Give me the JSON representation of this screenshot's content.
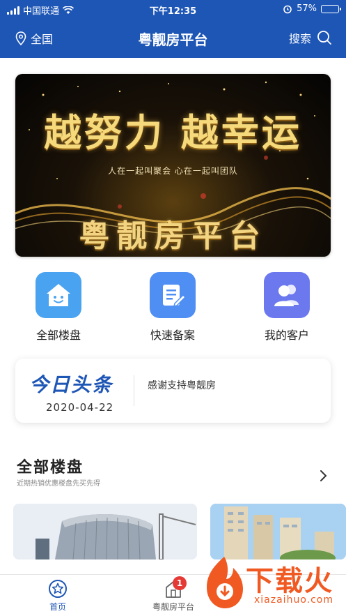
{
  "status_bar": {
    "carrier": "中国联通",
    "time": "下午12:35",
    "battery_percent": "57%",
    "battery_level": 0.57
  },
  "nav": {
    "location": "全国",
    "title": "粤靓房平台",
    "search_label": "搜索"
  },
  "banner": {
    "slogan": "越努力 越幸运",
    "subtitle": "人在一起叫聚会 心在一起叫团队",
    "brand": "粤靓房平台"
  },
  "actions": [
    {
      "label": "全部楼盘",
      "icon": "house-smile-icon",
      "color": "#4aa3f0"
    },
    {
      "label": "快速备案",
      "icon": "edit-document-icon",
      "color": "#4f8ef2"
    },
    {
      "label": "我的客户",
      "icon": "users-icon",
      "color": "#6b78ee"
    }
  ],
  "news": {
    "heading": "今日头条",
    "date": "2020-04-22",
    "text": "感谢支持粤靓房"
  },
  "section": {
    "title": "全部楼盘",
    "subtitle": "近期热销优惠楼盘先买先得"
  },
  "tabbar": {
    "items": [
      {
        "label": "首页",
        "icon": "star-circle-icon",
        "active": true
      },
      {
        "label": "粤靓房平台",
        "icon": "building-icon",
        "badge": "1"
      }
    ]
  },
  "watermark": {
    "text": "下载火",
    "url": "xiazaihuo.com"
  },
  "colors": {
    "primary": "#1e56b6",
    "banner_gold": "#f3d480",
    "badge_red": "#e53935",
    "watermark_orange": "#f05a22"
  }
}
